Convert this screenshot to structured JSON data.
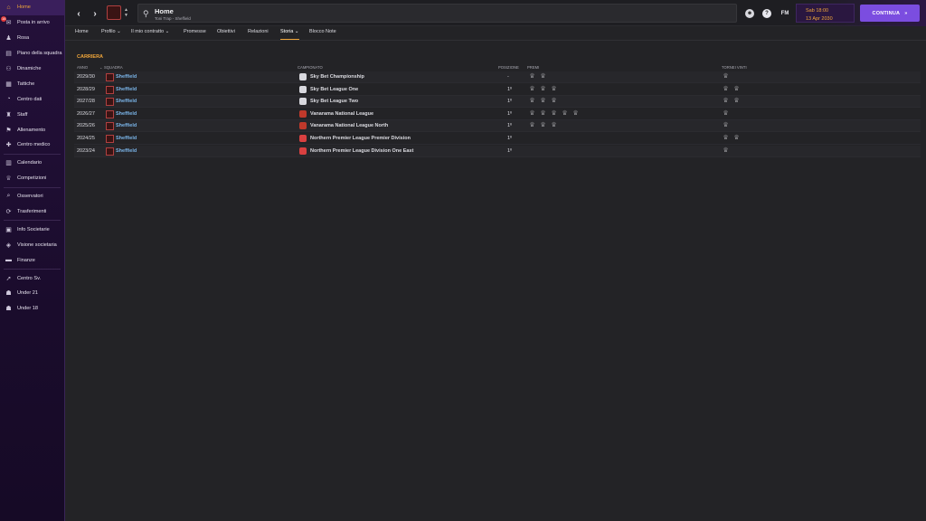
{
  "colors": {
    "accent": "#f0a63a",
    "brand_purple": "#7b4de0",
    "link": "#7ab4e8"
  },
  "sidebar": {
    "items": [
      {
        "label": "Home",
        "icon": "home-icon",
        "active": true
      },
      {
        "label": "Posta in arrivo",
        "icon": "inbox-icon",
        "badge": "16"
      },
      {
        "label": "Rosa",
        "icon": "shirt-icon"
      },
      {
        "label": "Piano della squadra",
        "icon": "clipboard-icon"
      },
      {
        "label": "Dinamiche",
        "icon": "dynamics-icon"
      },
      {
        "label": "Tattiche",
        "icon": "tactics-icon"
      },
      {
        "label": "Centro dati",
        "icon": "data-icon"
      },
      {
        "label": "Staff",
        "icon": "staff-icon"
      },
      {
        "label": "Allenamento",
        "icon": "training-icon"
      },
      {
        "label": "Centro medico",
        "icon": "medical-icon"
      },
      {
        "label": "Calendario",
        "icon": "calendar-icon"
      },
      {
        "label": "Competizioni",
        "icon": "trophy-icon"
      },
      {
        "label": "Osservatori",
        "icon": "scouting-icon"
      },
      {
        "label": "Trasferimenti",
        "icon": "transfers-icon"
      },
      {
        "label": "Info Societarie",
        "icon": "club-info-icon"
      },
      {
        "label": "Visione societaria",
        "icon": "club-vision-icon"
      },
      {
        "label": "Finanze",
        "icon": "finances-icon"
      },
      {
        "label": "Centro Sv.",
        "icon": "development-icon"
      },
      {
        "label": "Under 21",
        "icon": "u21-icon"
      },
      {
        "label": "Under 18",
        "icon": "u18-icon"
      }
    ]
  },
  "header": {
    "title": "Home",
    "subtitle": "Toni Trap - Sheffield",
    "date_day": "Sab 18:00",
    "date_date": "13 Apr 2030",
    "continue_label": "CONTINUA"
  },
  "tabs": [
    {
      "label": "Home"
    },
    {
      "label": "Profilo ⌄"
    },
    {
      "label": "Il mio contratto ⌄"
    },
    {
      "label": "Promesse"
    },
    {
      "label": "Obiettivi"
    },
    {
      "label": "Relazioni"
    },
    {
      "label": "Storia ⌄",
      "active": true
    },
    {
      "label": "Blocco Note"
    }
  ],
  "career": {
    "section_title": "CARRIERA",
    "headers": {
      "year": "ANNO",
      "team": "SQUADRA",
      "league": "CAMPIONATO",
      "position": "POSIZIONE",
      "awards": "PREMI",
      "trophies": "TORNEI VINTI"
    },
    "rows": [
      {
        "year": "2029/30",
        "team": "Sheffield",
        "league": "Sky Bet Championship",
        "position": "-",
        "awards": 2,
        "trophies": 1
      },
      {
        "year": "2028/29",
        "team": "Sheffield",
        "league": "Sky Bet League One",
        "position": "1º",
        "awards": 3,
        "trophies": 2
      },
      {
        "year": "2027/28",
        "team": "Sheffield",
        "league": "Sky Bet League Two",
        "position": "1º",
        "awards": 3,
        "trophies": 2
      },
      {
        "year": "2026/27",
        "team": "Sheffield",
        "league": "Vanarama National League",
        "position": "1º",
        "awards": 5,
        "trophies": 1
      },
      {
        "year": "2025/26",
        "team": "Sheffield",
        "league": "Vanarama National League North",
        "position": "1º",
        "awards": 3,
        "trophies": 1
      },
      {
        "year": "2024/25",
        "team": "Sheffield",
        "league": "Northern Premier League Premier Division",
        "position": "1º",
        "awards": 0,
        "trophies": 2
      },
      {
        "year": "2023/24",
        "team": "Sheffield",
        "league": "Northern Premier League Division One East",
        "position": "1º",
        "awards": 0,
        "trophies": 1
      }
    ]
  }
}
